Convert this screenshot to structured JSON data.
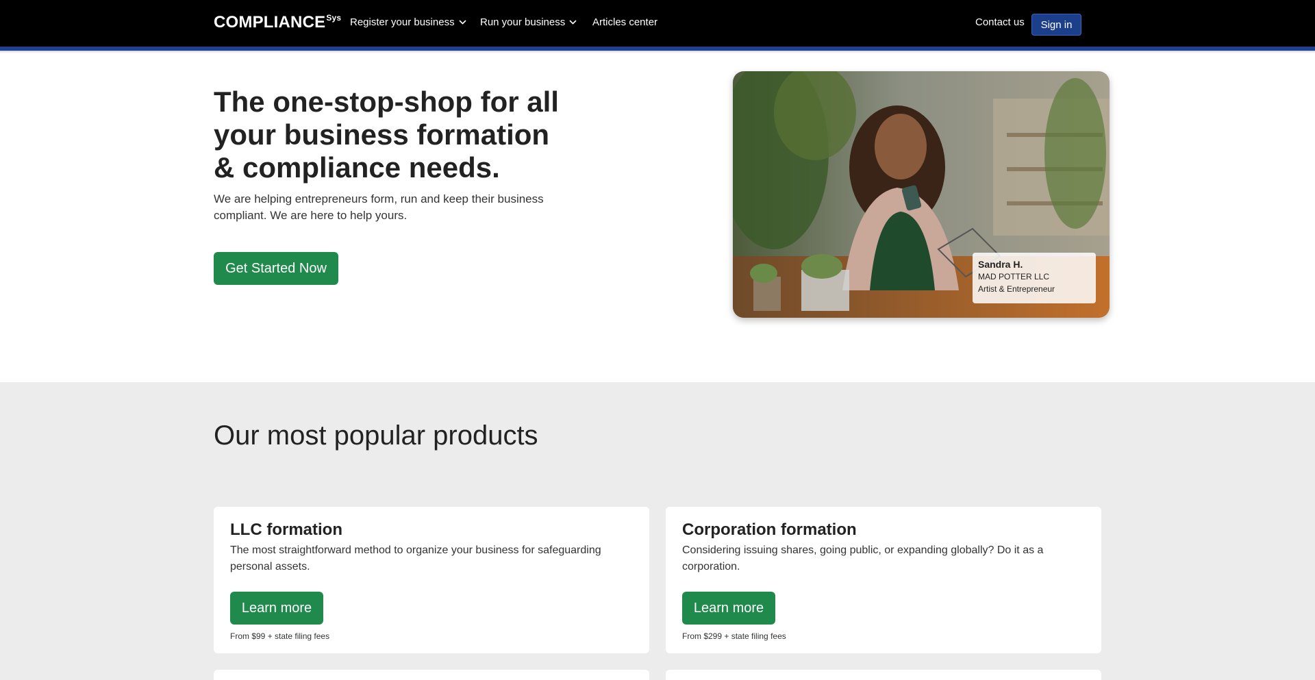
{
  "header": {
    "brand": "COMPLIANCE",
    "brand_sup": "Sys",
    "nav": {
      "register": "Register your business",
      "run": "Run your business",
      "articles": "Articles center"
    },
    "contact": "Contact us",
    "signin": "Sign in"
  },
  "hero": {
    "title": "The one-stop-shop for all your business formation & compliance needs.",
    "subtitle": "We are helping entrepreneurs form, run and keep their business compliant. We are here to help yours.",
    "cta": "Get Started Now",
    "testimonial": {
      "name": "Sandra H.",
      "company": "MAD POTTER LLC",
      "role": "Artist & Entrepreneur"
    }
  },
  "products": {
    "title": "Our most popular products",
    "cards": [
      {
        "title": "LLC formation",
        "description": "The most straightforward method to organize your business for safeguarding personal assets.",
        "button": "Learn more",
        "price": "From $99 + state filing fees"
      },
      {
        "title": "Corporation formation",
        "description": "Considering issuing shares, going public, or expanding globally? Do it as a corporation.",
        "button": "Learn more",
        "price": "From $299 + state filing fees"
      }
    ]
  },
  "colors": {
    "navbar": "#000000",
    "accent_blue": "#1c3f8c",
    "primary_green": "#1f8a4c",
    "section_gray": "#ececec"
  }
}
